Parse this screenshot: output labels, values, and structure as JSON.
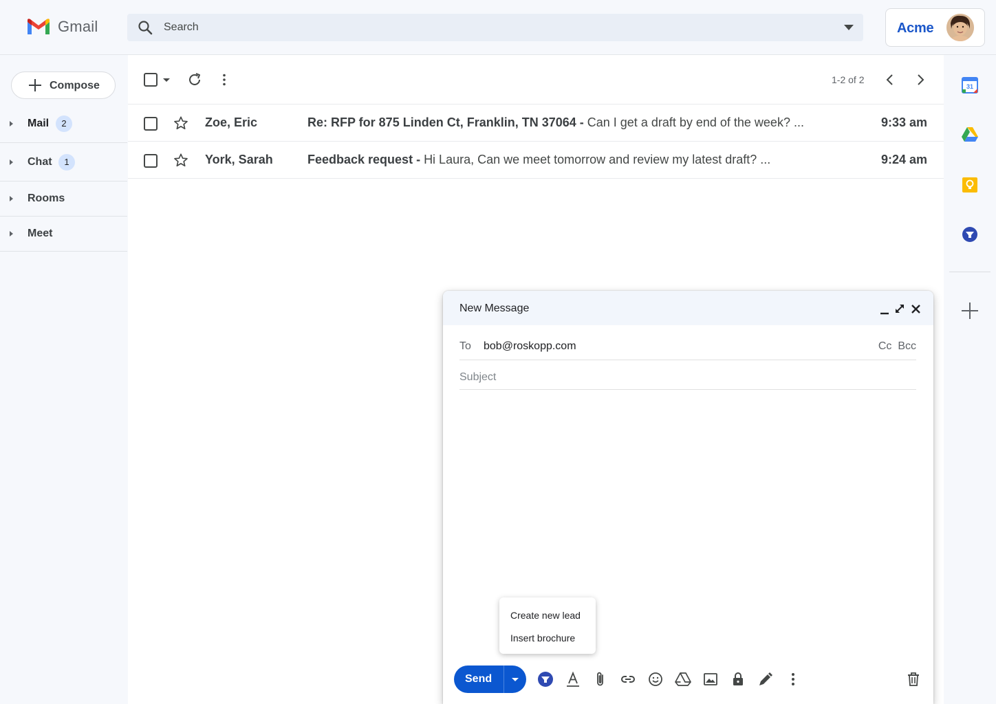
{
  "header": {
    "logo_text": "Gmail",
    "search_placeholder": "Search",
    "account_label": "Acme"
  },
  "sidebar": {
    "compose_label": "Compose",
    "items": [
      {
        "label": "Mail",
        "badge": "2"
      },
      {
        "label": "Chat",
        "badge": "1"
      },
      {
        "label": "Rooms",
        "badge": ""
      },
      {
        "label": "Meet",
        "badge": ""
      }
    ]
  },
  "toolbar": {
    "pager": "1-2 of 2"
  },
  "emails": [
    {
      "sender": "Zoe, Eric",
      "subject": "Re: RFP for 875 Linden Ct, Franklin, TN 37064",
      "separator": " - ",
      "snippet": "Can I get a draft by end of the week? ...",
      "time": "9:33 am"
    },
    {
      "sender": "York, Sarah",
      "subject": "Feedback request",
      "separator": " - ",
      "snippet": "Hi Laura, Can we meet tomorrow and review my latest draft? ...",
      "time": "9:24 am"
    }
  ],
  "compose": {
    "title": "New Message",
    "to_label": "To",
    "to_value": "bob@roskopp.com",
    "cc_bcc": "Cc  Bcc",
    "subject_placeholder": "Subject",
    "send_label": "Send",
    "menu_items": [
      "Create new lead",
      "Insert brochure"
    ]
  },
  "colors": {
    "accent": "#0b57d0",
    "brand": "#1a56c9",
    "badge": "#d3e3fd"
  }
}
